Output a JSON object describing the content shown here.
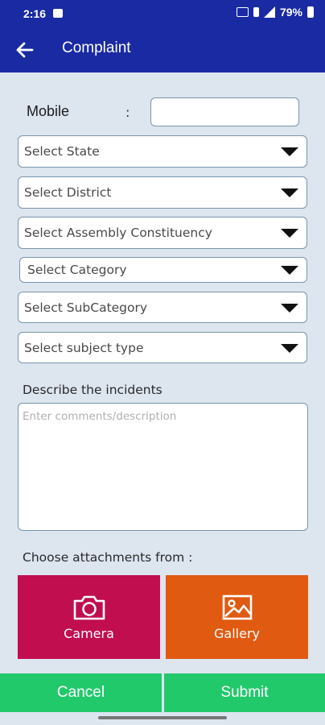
{
  "status_bar": {
    "time": "2:16",
    "battery": "79%"
  },
  "app_bar": {
    "title": "Complaint",
    "back_icon": "arrow-left-icon"
  },
  "form": {
    "mobile_label": "Mobile",
    "mobile_colon": ":",
    "mobile_value": "",
    "selects": [
      {
        "label": "Select State"
      },
      {
        "label": "Select District"
      },
      {
        "label": "Select Assembly Constituency"
      },
      {
        "label": "Select Category"
      },
      {
        "label": "Select SubCategory"
      },
      {
        "label": "Select subject type"
      }
    ],
    "description_label": "Describe the incidents",
    "description_placeholder": "Enter comments/description",
    "attachments_label": "Choose attachments from :"
  },
  "attachments": {
    "camera_label": "Camera",
    "gallery_label": "Gallery",
    "camera_color": "#c10e4f",
    "gallery_color": "#e05a11"
  },
  "actions": {
    "cancel_label": "Cancel",
    "submit_label": "Submit",
    "color": "#22c96b"
  },
  "colors": {
    "app_bar": "#1a2aa3",
    "background": "#dde5ef"
  }
}
